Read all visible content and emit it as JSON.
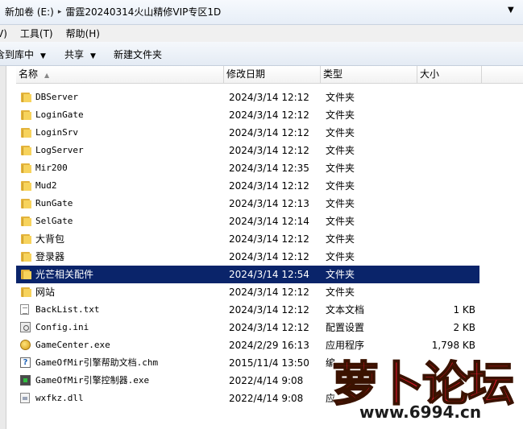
{
  "address": {
    "crumbs": [
      "新加卷 (E:)",
      "雷霆20240314火山精修VIP专区1D"
    ]
  },
  "menu": [
    {
      "label": "V)"
    },
    {
      "label": "工具(T)"
    },
    {
      "label": "帮助(H)"
    }
  ],
  "toolbar": {
    "include_label": "含到库中",
    "share_label": "共享",
    "new_folder_label": "新建文件夹"
  },
  "columns": {
    "name": "名称",
    "date": "修改日期",
    "type": "类型",
    "size": "大小"
  },
  "files": [
    {
      "name": "DBServer",
      "date": "2024/3/14 12:12",
      "type": "文件夹",
      "size": "",
      "icon": "folder-icon"
    },
    {
      "name": "LoginGate",
      "date": "2024/3/14 12:12",
      "type": "文件夹",
      "size": "",
      "icon": "folder-icon"
    },
    {
      "name": "LoginSrv",
      "date": "2024/3/14 12:12",
      "type": "文件夹",
      "size": "",
      "icon": "folder-icon"
    },
    {
      "name": "LogServer",
      "date": "2024/3/14 12:12",
      "type": "文件夹",
      "size": "",
      "icon": "folder-icon"
    },
    {
      "name": "Mir200",
      "date": "2024/3/14 12:35",
      "type": "文件夹",
      "size": "",
      "icon": "folder-icon"
    },
    {
      "name": "Mud2",
      "date": "2024/3/14 12:12",
      "type": "文件夹",
      "size": "",
      "icon": "folder-icon"
    },
    {
      "name": "RunGate",
      "date": "2024/3/14 12:13",
      "type": "文件夹",
      "size": "",
      "icon": "folder-icon"
    },
    {
      "name": "SelGate",
      "date": "2024/3/14 12:14",
      "type": "文件夹",
      "size": "",
      "icon": "folder-icon"
    },
    {
      "name": "大背包",
      "date": "2024/3/14 12:12",
      "type": "文件夹",
      "size": "",
      "icon": "folder-icon"
    },
    {
      "name": "登录器",
      "date": "2024/3/14 12:12",
      "type": "文件夹",
      "size": "",
      "icon": "folder-icon"
    },
    {
      "name": "光芒相关配件",
      "date": "2024/3/14 12:54",
      "type": "文件夹",
      "size": "",
      "icon": "folder-icon",
      "selected": true
    },
    {
      "name": "网站",
      "date": "2024/3/14 12:12",
      "type": "文件夹",
      "size": "",
      "icon": "folder-icon"
    },
    {
      "name": "BackList.txt",
      "date": "2024/3/14 12:12",
      "type": "文本文档",
      "size": "1 KB",
      "icon": "text-file-icon"
    },
    {
      "name": "Config.ini",
      "date": "2024/3/14 12:12",
      "type": "配置设置",
      "size": "2 KB",
      "icon": "config-file-icon"
    },
    {
      "name": "GameCenter.exe",
      "date": "2024/2/29 16:13",
      "type": "应用程序",
      "size": "1,798 KB",
      "icon": "app-icon"
    },
    {
      "name": "GameOfMir引擎帮助文档.chm",
      "date": "2015/11/4 13:50",
      "type": "编",
      "size": "",
      "icon": "help-file-icon"
    },
    {
      "name": "GameOfMir引擎控制器.exe",
      "date": "2022/4/14 9:08",
      "type": "",
      "size": "",
      "icon": "exe-icon"
    },
    {
      "name": "wxfkz.dll",
      "date": "2022/4/14 9:08",
      "type": "应",
      "size": "",
      "icon": "dll-file-icon"
    }
  ],
  "watermark": {
    "logo_text": "萝卜论坛",
    "url": "www.6994.cn"
  }
}
